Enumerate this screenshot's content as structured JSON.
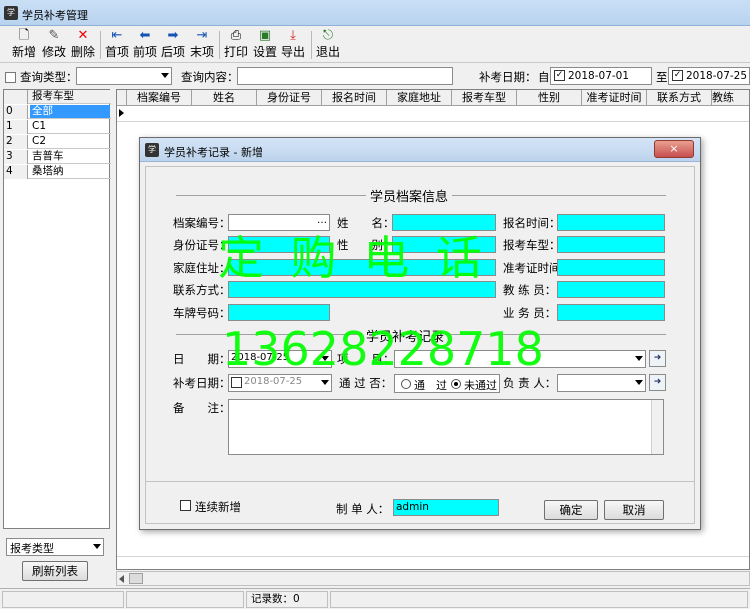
{
  "window": {
    "title": "学员补考管理"
  },
  "toolbar": {
    "new": "新增",
    "edit": "修改",
    "delete": "删除",
    "first": "首项",
    "prev": "前项",
    "next": "后项",
    "last": "末项",
    "print": "打印",
    "settings": "设置",
    "export": "导出",
    "exit": "退出"
  },
  "query": {
    "type_label": "查询类型：",
    "content_label": "查询内容：",
    "date_label": "补考日期：",
    "from_label": "自",
    "from_date": "2018-07-01",
    "to_label": "至",
    "to_date": "2018-07-25"
  },
  "left_list": {
    "header": "报考车型",
    "rows": [
      {
        "n": "0",
        "v": "全部"
      },
      {
        "n": "1",
        "v": "C1"
      },
      {
        "n": "2",
        "v": "C2"
      },
      {
        "n": "3",
        "v": "吉普车"
      },
      {
        "n": "4",
        "v": "桑塔纳"
      }
    ],
    "filter_value": "报考类型",
    "refresh_label": "刷新列表"
  },
  "grid": {
    "columns": [
      "档案编号",
      "姓名",
      "身份证号",
      "报名时间",
      "家庭地址",
      "报考车型",
      "性别",
      "准考证时间",
      "联系方式",
      "教练"
    ]
  },
  "dialog": {
    "title": "学员补考记录 - 新增",
    "close": "×",
    "section1": "学员档案信息",
    "section2": "学员补考记录",
    "fields": {
      "file_no": "档案编号：",
      "name": "姓　　名：",
      "reg_time": "报名时间：",
      "id_no": "身份证号：",
      "gender": "性　　别：",
      "car_type": "报考车型：",
      "address": "家庭住址：",
      "exam_time": "准考证时间：",
      "contact": "联系方式：",
      "coach": "教 练 员：",
      "plate": "车牌号码：",
      "salesman": "业 务 员：",
      "date": "日　　期：",
      "date_value": "2018-07-25",
      "item": "项　　目：",
      "retake_date": "补考日期：",
      "retake_date_value": "2018-07-25",
      "passed": "通 过 否：",
      "pass": "通　过",
      "fail": "未通过",
      "owner": "负 责 人：",
      "remark": "备　　注："
    },
    "continuous": "连续新增",
    "maker_label": "制 单 人：",
    "maker_value": "admin",
    "ok": "确定",
    "cancel": "取消"
  },
  "watermark": {
    "line1": "定 购 电 话",
    "line2": "13628228718"
  },
  "status": {
    "count_label": "记录数：0"
  }
}
